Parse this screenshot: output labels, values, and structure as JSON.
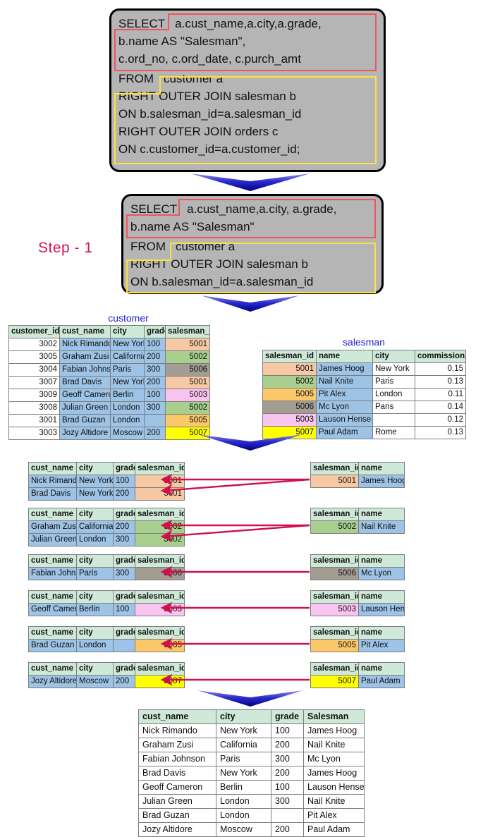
{
  "step_label": "Step - 1",
  "colors": {
    "accent_step": "#d4145a",
    "arrow_blue": "#1a1ac0",
    "arrow_crimson": "#d0104c",
    "select_outline": "#f3545a",
    "from_outline": "#ffe13b",
    "sql_bg": "#b5b5b5",
    "table_header": "#cfe9d8",
    "name_cell": "#9dc3e6"
  },
  "sql_full": {
    "lines": [
      {
        "kw": "SELECT",
        "rest": "a.cust_name,a.city,a.grade,"
      },
      {
        "kw": "",
        "rest": "b.name AS \"Salesman\","
      },
      {
        "kw": "",
        "rest": "c.ord_no, c.ord_date, c.purch_amt"
      },
      {
        "kw": "FROM",
        "rest": "customer a"
      },
      {
        "kw": "",
        "rest": "RIGHT OUTER JOIN salesman b"
      },
      {
        "kw": "",
        "rest": "ON b.salesman_id=a.salesman_id"
      },
      {
        "kw": "",
        "rest": "RIGHT OUTER JOIN orders c"
      },
      {
        "kw": "",
        "rest": "ON c.customer_id=a.customer_id;"
      }
    ]
  },
  "sql_step1": {
    "lines": [
      {
        "kw": "SELECT",
        "rest": "a.cust_name,a.city, a.grade,"
      },
      {
        "kw": "",
        "rest": "b.name AS \"Salesman\""
      },
      {
        "kw": "FROM",
        "rest": "customer a"
      },
      {
        "kw": "",
        "rest": "RIGHT OUTER JOIN salesman b"
      },
      {
        "kw": "",
        "rest": "ON b.salesman_id=a.salesman_id"
      }
    ]
  },
  "customer_table": {
    "title": "customer",
    "headers": [
      "customer_id",
      "cust_name",
      "city",
      "grade",
      "salesman_id"
    ],
    "rows": [
      {
        "customer_id": "3002",
        "cust_name": "Nick Rimando",
        "city": "New York",
        "grade": "100",
        "salesman_id": "5001",
        "sid_color": "c-peach"
      },
      {
        "customer_id": "3005",
        "cust_name": "Graham Zusi",
        "city": "California",
        "grade": "200",
        "salesman_id": "5002",
        "sid_color": "c-green"
      },
      {
        "customer_id": "3004",
        "cust_name": "Fabian Johnson",
        "city": "Paris",
        "grade": "300",
        "salesman_id": "5006",
        "sid_color": "c-gray"
      },
      {
        "customer_id": "3007",
        "cust_name": "Brad Davis",
        "city": "New York",
        "grade": "200",
        "salesman_id": "5001",
        "sid_color": "c-peach"
      },
      {
        "customer_id": "3009",
        "cust_name": "Geoff Cameron",
        "city": "Berlin",
        "grade": "100",
        "salesman_id": "5003",
        "sid_color": "c-pink"
      },
      {
        "customer_id": "3008",
        "cust_name": "Julian Green",
        "city": "London",
        "grade": "300",
        "salesman_id": "5002",
        "sid_color": "c-green"
      },
      {
        "customer_id": "3001",
        "cust_name": "Brad Guzan",
        "city": "London",
        "grade": "",
        "salesman_id": "5005",
        "sid_color": "c-orange"
      },
      {
        "customer_id": "3003",
        "cust_name": "Jozy Altidore",
        "city": "Moscow",
        "grade": "200",
        "salesman_id": "5007",
        "sid_color": "c-yellow"
      }
    ]
  },
  "salesman_table": {
    "title": "salesman",
    "headers": [
      "salesman_id",
      "name",
      "city",
      "commission"
    ],
    "rows": [
      {
        "salesman_id": "5001",
        "name": "James Hoog",
        "city": "New York",
        "commission": "0.15",
        "sid_color": "c-peach"
      },
      {
        "salesman_id": "5002",
        "name": "Nail Knite",
        "city": "Paris",
        "commission": "0.13",
        "sid_color": "c-green"
      },
      {
        "salesman_id": "5005",
        "name": "Pit Alex",
        "city": "London",
        "commission": "0.11",
        "sid_color": "c-orange"
      },
      {
        "salesman_id": "5006",
        "name": "Mc Lyon",
        "city": "Paris",
        "commission": "0.14",
        "sid_color": "c-gray"
      },
      {
        "salesman_id": "5003",
        "name": "Lauson Hense",
        "city": "",
        "commission": "0.12",
        "sid_color": "c-pink"
      },
      {
        "salesman_id": "5007",
        "name": "Paul Adam",
        "city": "Rome",
        "commission": "0.13",
        "sid_color": "c-yellow"
      }
    ]
  },
  "join_pairs": {
    "left_headers": [
      "cust_name",
      "city",
      "grade",
      "salesman_id"
    ],
    "right_headers": [
      "salesman_id",
      "name"
    ],
    "groups": [
      {
        "color": "c-peach",
        "left_rows": [
          {
            "cust_name": "Nick Rimando",
            "city": "New York",
            "grade": "100",
            "salesman_id": "5001"
          },
          {
            "cust_name": "Brad Davis",
            "city": "New York",
            "grade": "200",
            "salesman_id": "5001"
          }
        ],
        "right_rows": [
          {
            "salesman_id": "5001",
            "name": "James Hoog"
          }
        ]
      },
      {
        "color": "c-green",
        "left_rows": [
          {
            "cust_name": "Graham Zusi",
            "city": "California",
            "grade": "200",
            "salesman_id": "5002"
          },
          {
            "cust_name": "Julian Green",
            "city": "London",
            "grade": "300",
            "salesman_id": "5002"
          }
        ],
        "right_rows": [
          {
            "salesman_id": "5002",
            "name": "Nail Knite"
          }
        ]
      },
      {
        "color": "c-gray",
        "left_rows": [
          {
            "cust_name": "Fabian Johnson",
            "city": "Paris",
            "grade": "300",
            "salesman_id": "5006"
          }
        ],
        "right_rows": [
          {
            "salesman_id": "5006",
            "name": "Mc Lyon"
          }
        ]
      },
      {
        "color": "c-pink",
        "left_rows": [
          {
            "cust_name": "Geoff Cameron",
            "city": "Berlin",
            "grade": "100",
            "salesman_id": "5003"
          }
        ],
        "right_rows": [
          {
            "salesman_id": "5003",
            "name": "Lauson Hense"
          }
        ]
      },
      {
        "color": "c-orange",
        "left_rows": [
          {
            "cust_name": "Brad Guzan",
            "city": "London",
            "grade": "",
            "salesman_id": "5005"
          }
        ],
        "right_rows": [
          {
            "salesman_id": "5005",
            "name": "Pit Alex"
          }
        ]
      },
      {
        "color": "c-yellow",
        "left_rows": [
          {
            "cust_name": "Jozy Altidore",
            "city": "Moscow",
            "grade": "200",
            "salesman_id": "5007"
          }
        ],
        "right_rows": [
          {
            "salesman_id": "5007",
            "name": "Paul Adam"
          }
        ]
      }
    ]
  },
  "result_table": {
    "headers": [
      "cust_name",
      "city",
      "grade",
      "Salesman"
    ],
    "rows": [
      {
        "cust_name": "Nick Rimando",
        "city": "New York",
        "grade": "100",
        "Salesman": "James Hoog"
      },
      {
        "cust_name": "Graham Zusi",
        "city": "California",
        "grade": "200",
        "Salesman": "Nail Knite"
      },
      {
        "cust_name": "Fabian Johnson",
        "city": "Paris",
        "grade": "300",
        "Salesman": "Mc Lyon"
      },
      {
        "cust_name": "Brad Davis",
        "city": "New York",
        "grade": "200",
        "Salesman": "James Hoog"
      },
      {
        "cust_name": "Geoff Cameron",
        "city": "Berlin",
        "grade": "100",
        "Salesman": "Lauson Hense"
      },
      {
        "cust_name": "Julian Green",
        "city": "London",
        "grade": "300",
        "Salesman": "Nail Knite"
      },
      {
        "cust_name": "Brad Guzan",
        "city": "London",
        "grade": "",
        "Salesman": "Pit Alex"
      },
      {
        "cust_name": "Jozy Altidore",
        "city": "Moscow",
        "grade": "200",
        "Salesman": "Paul Adam"
      }
    ]
  }
}
